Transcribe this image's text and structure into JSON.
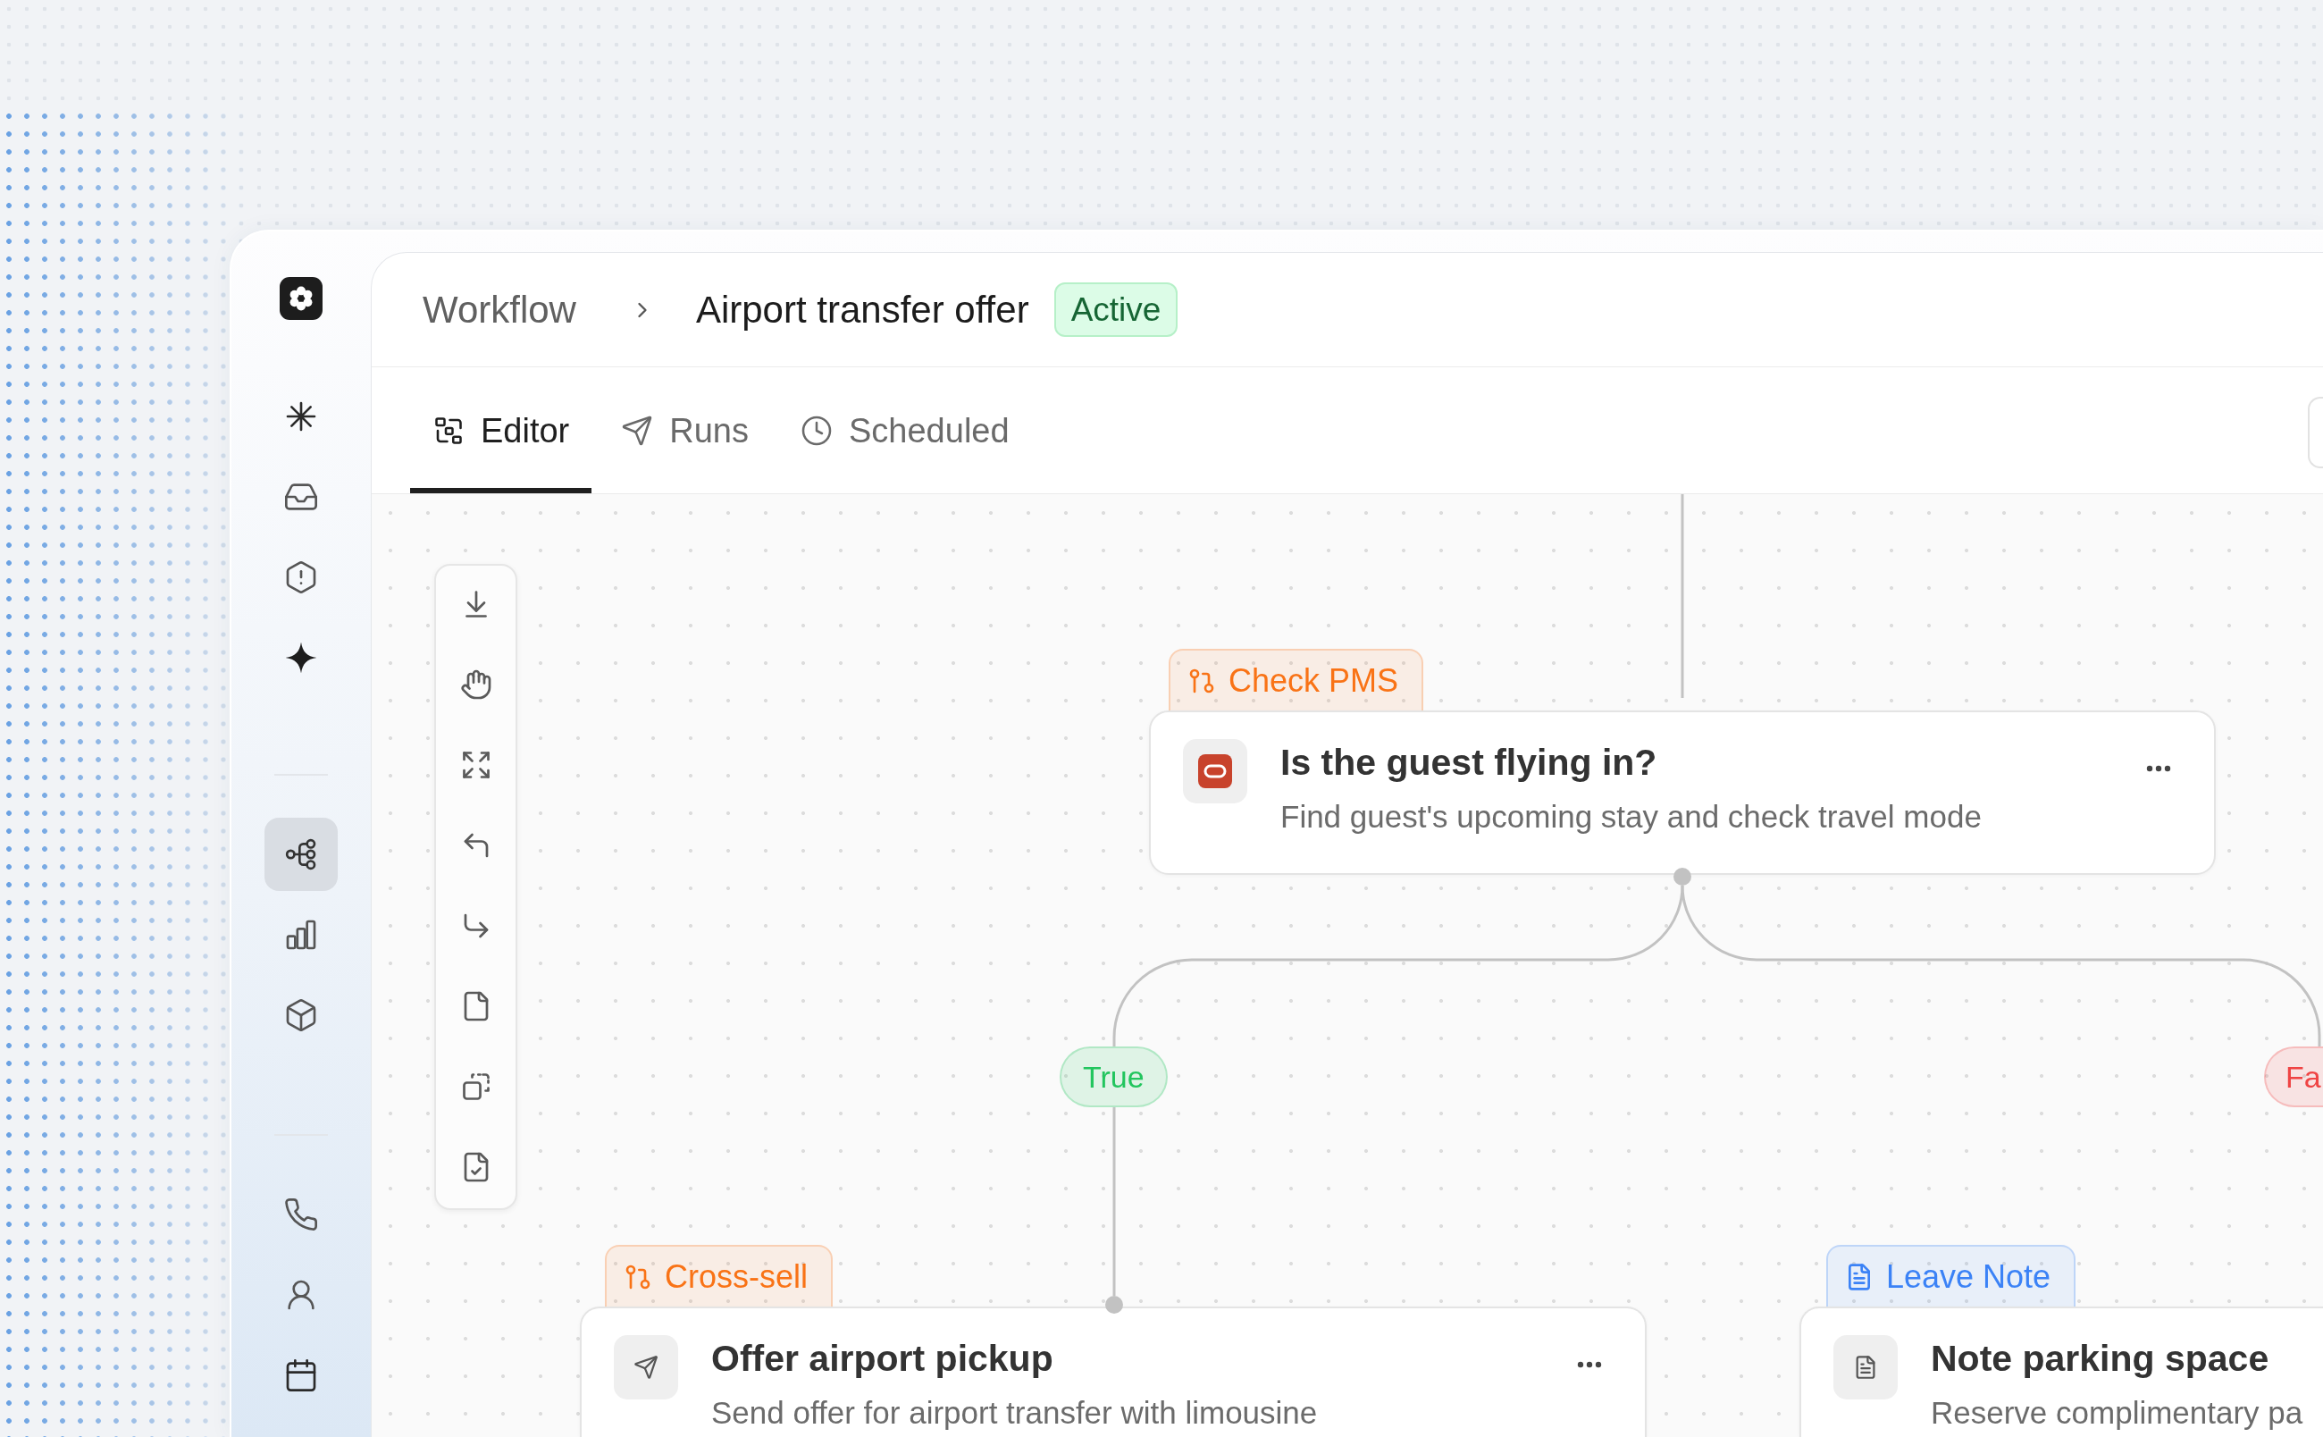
{
  "sidebar": {
    "groups": [
      [
        {
          "selected": false
        },
        {
          "selected": false
        },
        {
          "selected": false
        },
        {
          "selected": false
        }
      ],
      [
        {
          "selected": true
        },
        {
          "selected": false
        },
        {
          "selected": false
        }
      ],
      [
        {
          "selected": false
        },
        {
          "selected": false
        },
        {
          "selected": false
        }
      ]
    ]
  },
  "header": {
    "breadcrumbs": [
      "Workflow",
      "Airport transfer offer"
    ],
    "status": "Active"
  },
  "tabs": [
    {
      "label": "Editor",
      "selected": true
    },
    {
      "label": "Runs",
      "selected": false
    },
    {
      "label": "Scheduled",
      "selected": false
    }
  ],
  "canvas": {
    "nodes": [
      {
        "kind": "pms",
        "tag": {
          "kind": "branch",
          "label": "Check PMS",
          "color": "#f97316"
        },
        "title": "Is the guest flying in?",
        "description": "Find guest's upcoming stay and check travel mode",
        "menu": true
      },
      {
        "kind": "send",
        "tag": {
          "kind": "branch",
          "label": "Cross-sell",
          "color": "#f97316"
        },
        "title": "Offer airport pickup",
        "description": "Send offer for airport transfer with limousine",
        "menu": true
      },
      {
        "kind": "note",
        "tag": {
          "kind": "note",
          "label": "Leave Note",
          "color": "#3b82f6"
        },
        "title": "Note parking space",
        "description": "Reserve complimentary pa",
        "menu": false
      }
    ],
    "branches": [
      {
        "label": "True",
        "color": "#22c55e"
      },
      {
        "label": "Fa",
        "color": "#ef4444"
      }
    ]
  }
}
